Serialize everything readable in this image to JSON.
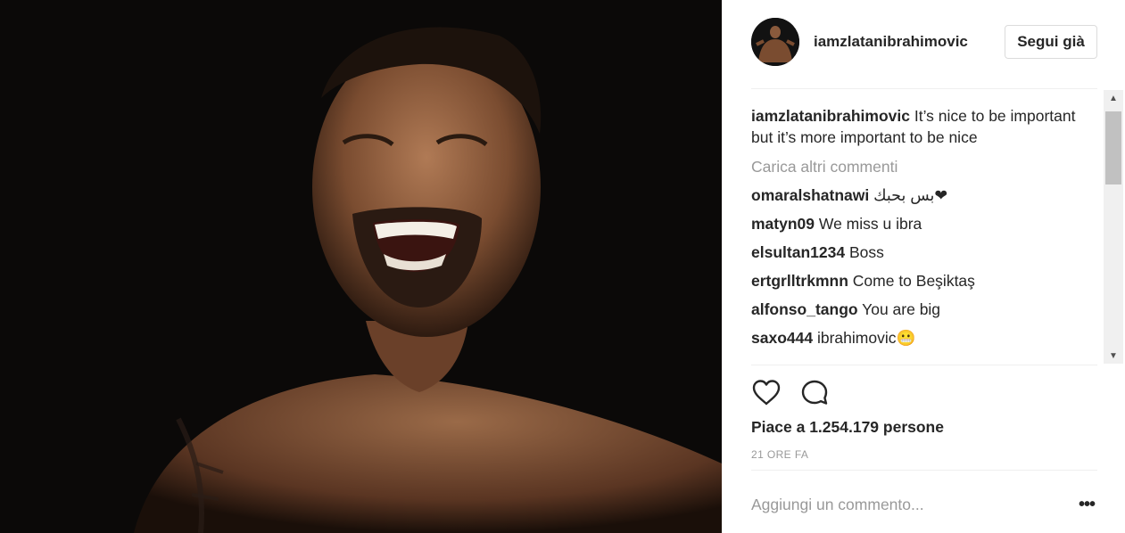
{
  "post": {
    "username": "iamzlatanibrahimovic",
    "follow_label": "Segui già",
    "caption_text": "It’s nice to be important but it’s more important to be nice",
    "load_more_label": "Carica altri commenti",
    "comments": [
      {
        "user": "omaralshatnawi",
        "text": "بس بحبك❤"
      },
      {
        "user": "matyn09",
        "text": "We miss u ibra"
      },
      {
        "user": "elsultan1234",
        "text": "Boss"
      },
      {
        "user": "ertgrlltrkmnn",
        "text": "Come to Beşiktaş"
      },
      {
        "user": "alfonso_tango",
        "text": "You are big"
      },
      {
        "user": "saxo444",
        "text": "ibrahimovic😬"
      }
    ],
    "likes_text": "Piace a 1.254.179 persone",
    "timestamp": "21 ORE FA",
    "add_comment_placeholder": "Aggiungi un commento...",
    "more_options_label": "•••"
  },
  "icons": {
    "like": "heart-outline-icon",
    "comment": "speech-bubble-icon",
    "scroll_up": "triangle-up-icon",
    "scroll_down": "triangle-down-icon"
  },
  "colors": {
    "text": "#262626",
    "secondary": "#999999",
    "border": "#dbdbdb",
    "photo_background": "#0b0908"
  }
}
